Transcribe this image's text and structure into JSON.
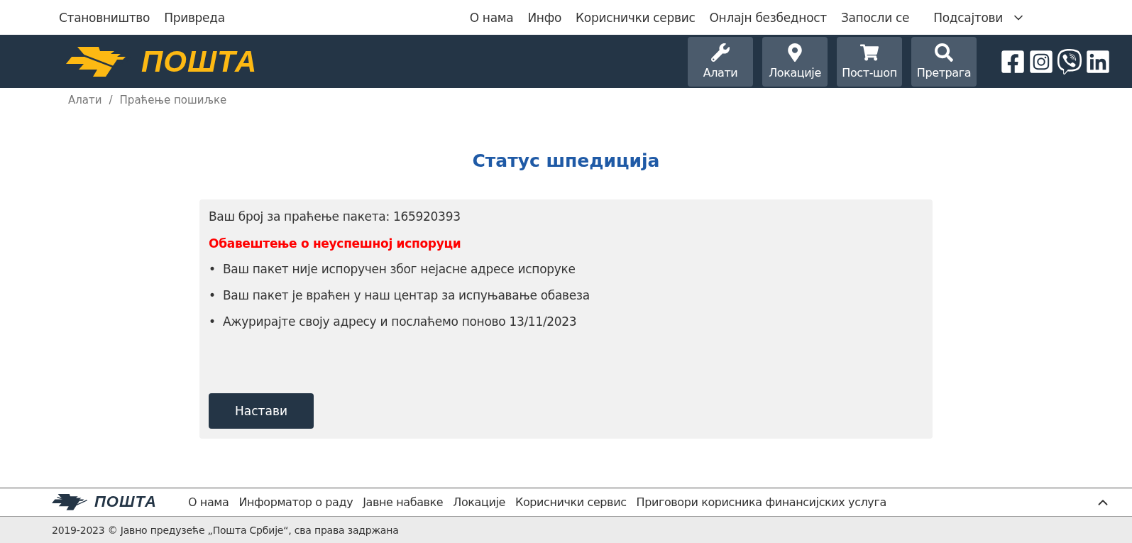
{
  "top_nav": {
    "left": [
      "Становништво",
      "Привреда"
    ],
    "right": [
      "О нама",
      "Инфо",
      "Кориснички сервис",
      "Онлајн безбедност",
      "Запосли се"
    ],
    "dropdown": "Подсајтови"
  },
  "header": {
    "logo": "ПОШТА",
    "tools": [
      {
        "kind": "wrench",
        "label": "Алати"
      },
      {
        "kind": "pin",
        "label": "Локације"
      },
      {
        "kind": "cart",
        "label": "Пост-шоп"
      },
      {
        "kind": "search",
        "label": "Претрага"
      }
    ],
    "social": [
      {
        "kind": "facebook"
      },
      {
        "kind": "instagram"
      },
      {
        "kind": "viber"
      },
      {
        "kind": "linkedin"
      }
    ]
  },
  "breadcrumb": [
    "Алати",
    "Праћење пошиљке"
  ],
  "breadcrumb_separator": "/",
  "title": "Статус шпедиција",
  "card": {
    "tracking": "Ваш број за праћење пакета: 165920393",
    "notice": "Обавештење о неуспешној испоруци",
    "bullet_mark": "•",
    "bullets": [
      "Ваш пакет није испоручен због нејасне адресе испоруке",
      "Ваш пакет је враћен у наш центар за испуњавање обавеза",
      "Ажурирајте своју адресу и послаћемо поново 13/11/2023"
    ],
    "button": "Настави"
  },
  "footer": {
    "logo": "ПОШТА",
    "links": [
      "О нама",
      "Информатор о раду",
      "Јавне набавке",
      "Локације",
      "Кориснички сервис",
      "Приговори корисника финансијских услуга"
    ],
    "copyright": "2019-2023 © Јавно предузеће „Пошта Србије“, сва права задржана"
  }
}
